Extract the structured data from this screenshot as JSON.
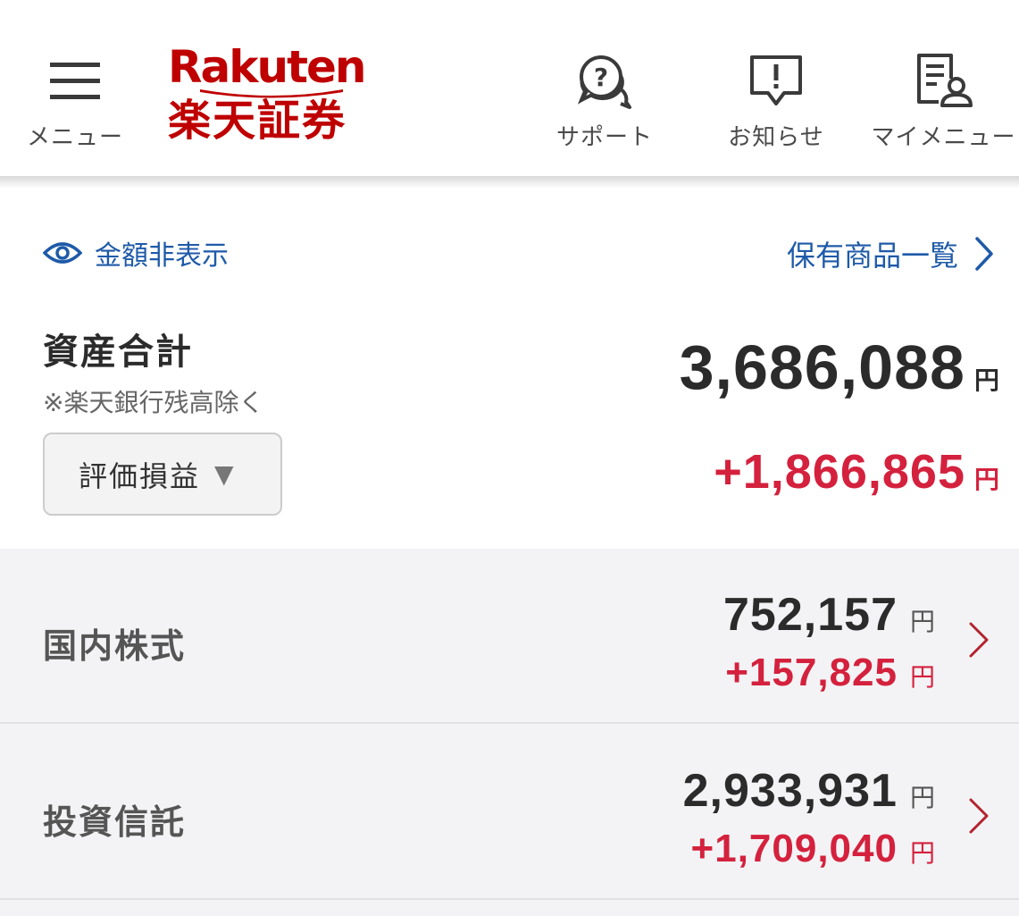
{
  "header": {
    "menu_label": "メニュー",
    "logo_word": "Rakuten",
    "logo_jp": "楽天証券",
    "support_label": "サポート",
    "notice_label": "お知らせ",
    "mymenu_label": "マイメニュー"
  },
  "summary": {
    "hide_amount_label": "金額非表示",
    "holdings_link_label": "保有商品一覧",
    "asset_title": "資産合計",
    "asset_note": "※楽天銀行残高除く",
    "total_amount": "3,686,088",
    "currency": "円",
    "pl_selector_label": "評価損益",
    "pl_selector_arrow": "▼",
    "total_pl": "+1,866,865"
  },
  "categories": [
    {
      "name": "国内株式",
      "value": "752,157",
      "pl": "+157,825",
      "currency": "円"
    },
    {
      "name": "投資信託",
      "value": "2,933,931",
      "pl": "+1,709,040",
      "currency": "円"
    }
  ],
  "colors": {
    "brand": "#bf0000",
    "link": "#1e5aa8",
    "gain": "#d4213d",
    "row_bg": "#f3f3f5"
  },
  "icons": {
    "menu": "hamburger-icon",
    "support": "question-chat-icon",
    "notice": "exclamation-chat-icon",
    "mymenu": "document-user-icon",
    "hide": "eye-icon",
    "link": "chevron-right-icon"
  }
}
